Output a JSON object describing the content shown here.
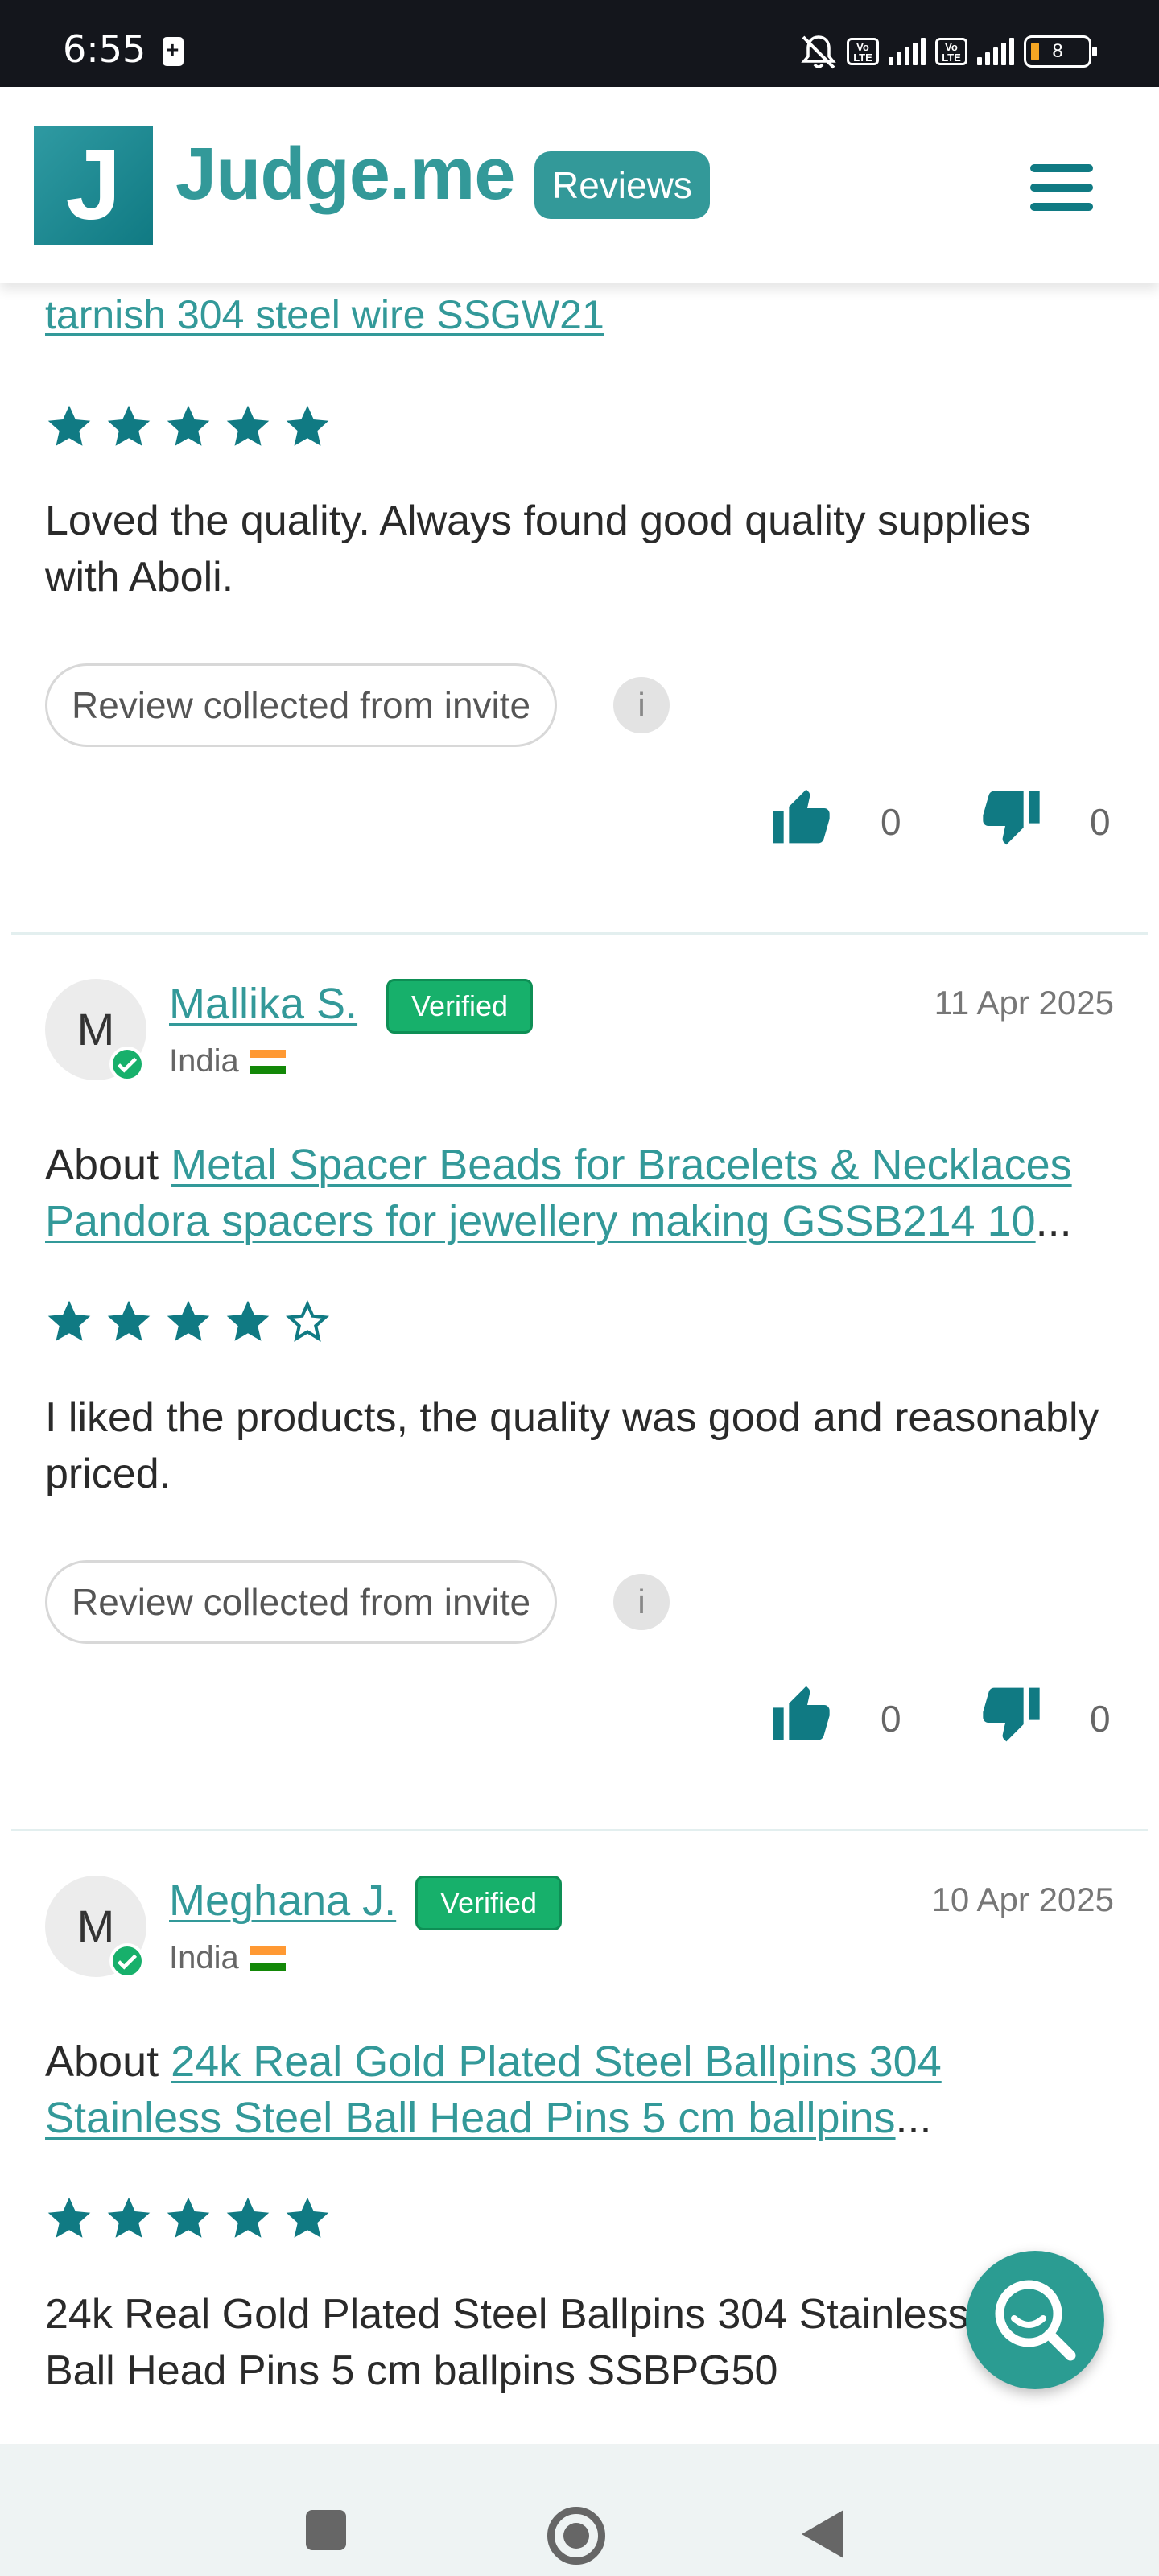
{
  "status_bar": {
    "time": "6:55",
    "battery_level": "8",
    "icons": [
      "battery-saver-icon",
      "mute-icon",
      "volte-icon",
      "signal-4g-icon",
      "volte-icon",
      "signal-icon",
      "battery-icon"
    ]
  },
  "header": {
    "logo_letter": "J",
    "brand": "Judge.me",
    "badge": "Reviews",
    "menu_icon": "hamburger-icon"
  },
  "reviews": [
    {
      "product_link_tail": "tarnish 304 steel wire SSGW21",
      "rating": 5,
      "body": "Loved the quality. Always found good quality supplies with Aboli.",
      "source": "Review collected from invite",
      "info_label": "i",
      "thumbs_up": "0",
      "thumbs_down": "0"
    },
    {
      "initial": "M",
      "name": "Mallika S.",
      "verified": "Verified",
      "country": "India",
      "date": "11 Apr 2025",
      "about_prefix": "About",
      "product_link": "Metal Spacer Beads for Bracelets & Necklaces Pandora spacers for jewellery making GSSB214 10",
      "ellipsis": "...",
      "rating": 4,
      "body": "I liked the products, the quality was good and reasonably priced.",
      "source": "Review collected from invite",
      "info_label": "i",
      "thumbs_up": "0",
      "thumbs_down": "0"
    },
    {
      "initial": "M",
      "name": "Meghana J.",
      "verified": "Verified",
      "country": "India",
      "date": "10 Apr 2025",
      "about_prefix": "About",
      "product_link": "24k Real Gold Plated Steel Ballpins 304 Stainless Steel Ball Head Pins 5 cm ballpins",
      "ellipsis": "...",
      "rating": 5,
      "body": "24k Real Gold Plated Steel Ballpins 304 Stainless Steel Ball Head Pins 5 cm ballpins SSBPG50"
    }
  ],
  "colors": {
    "brand_teal": "#339999",
    "star": "#107a83",
    "verified_green": "#17b06b",
    "fab": "#2b9c92"
  },
  "fab_icon": "search-icon",
  "nav": {
    "recents_icon": "square-icon",
    "home_icon": "home-circle-icon",
    "back_icon": "back-triangle-icon"
  }
}
